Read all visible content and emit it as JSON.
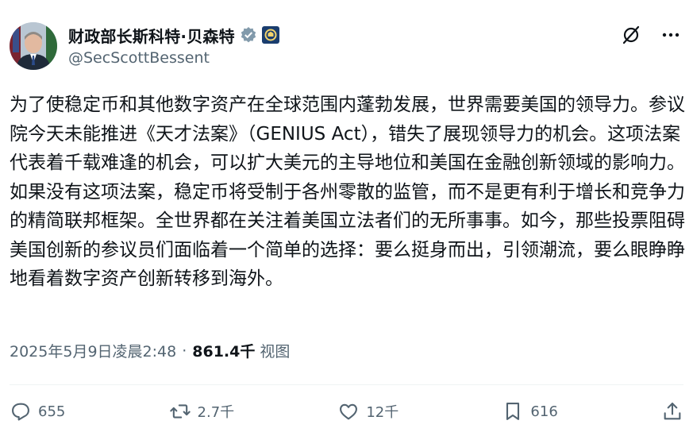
{
  "author": {
    "display_name": "财政部长斯科特·贝森特",
    "handle": "@SecScottBessent",
    "verified": true
  },
  "tweet": {
    "text": "为了使稳定币和其他数字资产在全球范围内蓬勃发展，世界需要美国的领导力。参议院今天未能推进《天才法案》（GENIUS Act），错失了展现领导力的机会。这项法案代表着千载难逢的机会，可以扩大美元的主导地位和美国在金融创新领域的影响力。如果没有这项法案，稳定币将受制于各州零散的监管，而不是更有利于增长和竞争力的精简联邦框架。全世界都在关注着美国立法者们的无所事事。如今，那些投票阻碍美国创新的参议员们面临着一个简单的选择：要么挺身而出，引领潮流，要么眼睁睁地看着数字资产创新转移到海外。",
    "timestamp": "2025年5月9日凌晨2:48",
    "separator": "·",
    "views_count": "861.4千",
    "views_label": "视图"
  },
  "actions": {
    "replies": "655",
    "reposts": "2.7千",
    "likes": "12千",
    "bookmarks": "616"
  },
  "icons": [
    "verified-badge-icon",
    "treasury-seal-icon",
    "grok-icon",
    "more-icon",
    "reply-icon",
    "repost-icon",
    "like-icon",
    "bookmark-icon",
    "share-icon"
  ],
  "colors": {
    "text": "#0f1419",
    "secondary": "#536471",
    "verified": "#829aab",
    "divider": "#eff3f4"
  }
}
